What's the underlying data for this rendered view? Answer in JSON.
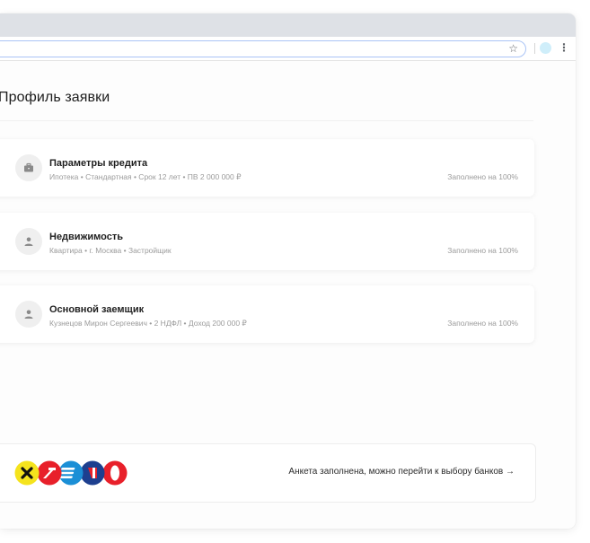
{
  "browser": {
    "star_glyph": "☆",
    "menu_glyph": "⋮",
    "avatar_color": "#cfeefa"
  },
  "page": {
    "title": "Профиль заявки"
  },
  "cards": [
    {
      "icon": "briefcase-icon",
      "title": "Параметры кредита",
      "subtitle": "Ипотека  •  Стандартная   •  Срок 12 лет  •  ПВ 2 000 000 ₽",
      "status": "Заполнено на 100%"
    },
    {
      "icon": "person-icon",
      "title": "Недвижимость",
      "subtitle": "Квартира   •  г. Москва  •  Застройщик",
      "status": "Заполнено на 100%"
    },
    {
      "icon": "person-icon",
      "title": "Основной заемщик",
      "subtitle": "Кузнецов Мирон Сергеевич   •  2 НДФЛ  •  Доход 200 000 ₽",
      "status": "Заполнено на 100%"
    }
  ],
  "footer": {
    "message": "Анкета заполнена, можно перейти к выбору банков →",
    "bank_logos": [
      "x-bank-logo",
      "arrow-bank-logo",
      "lines-bank-logo",
      "blue-bank-logo",
      "red-ring-bank-logo"
    ],
    "bank_colors": [
      "#f5e31d",
      "#e8202a",
      "#1b8fd6",
      "#1d3f8f",
      "#e8202a"
    ]
  }
}
